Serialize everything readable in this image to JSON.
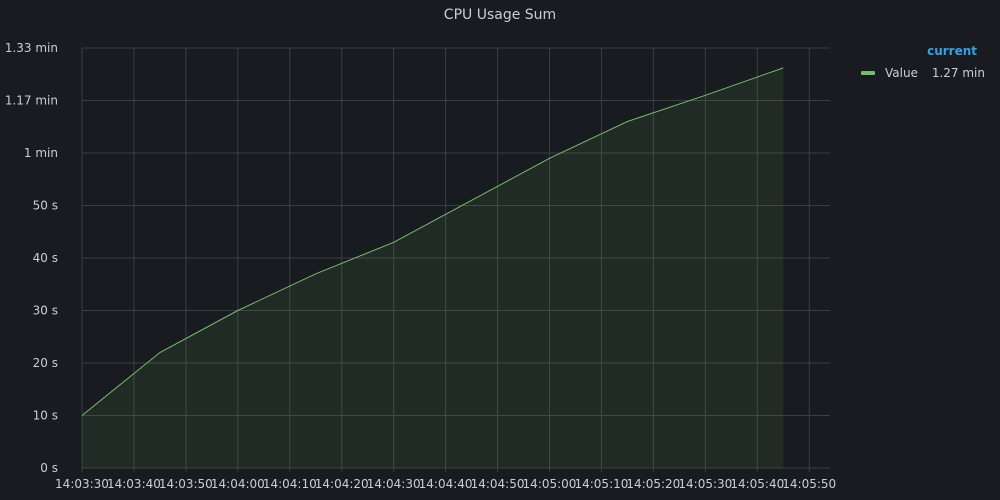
{
  "panel": {
    "title": "CPU Usage Sum"
  },
  "legend": {
    "header": "current",
    "items": [
      {
        "name": "Value",
        "current": "1.27 min",
        "color": "#73bf69"
      }
    ]
  },
  "colors": {
    "background": "#181b1f",
    "grid": "#3a3d42",
    "text": "#ccccdc",
    "series": "#73bf69",
    "legend_header": "#33a2e5"
  },
  "chart_data": {
    "type": "area",
    "title": "CPU Usage Sum",
    "xlabel": "",
    "ylabel": "",
    "grid": true,
    "legend_placement": "right",
    "x_unit": "time",
    "y_unit": "seconds",
    "x_tick_labels": [
      "14:03:30",
      "14:03:40",
      "14:03:50",
      "14:04:00",
      "14:04:10",
      "14:04:20",
      "14:04:30",
      "14:04:40",
      "14:04:50",
      "14:05:00",
      "14:05:10",
      "14:05:20",
      "14:05:30",
      "14:05:40",
      "14:05:50"
    ],
    "y_tick_values": [
      0,
      10,
      20,
      30,
      40,
      50,
      60,
      70,
      80
    ],
    "y_tick_labels": [
      "0 s",
      "10 s",
      "20 s",
      "30 s",
      "40 s",
      "50 s",
      "1 min",
      "1.17 min",
      "1.33 min"
    ],
    "xlim": [
      "14:03:30",
      "14:05:54"
    ],
    "ylim": [
      0,
      80
    ],
    "series": [
      {
        "name": "Value",
        "color": "#73bf69",
        "x": [
          "14:03:30",
          "14:03:45",
          "14:04:00",
          "14:04:15",
          "14:04:30",
          "14:04:45",
          "14:05:00",
          "14:05:15",
          "14:05:30",
          "14:05:45"
        ],
        "y": [
          10,
          22,
          30,
          37,
          43,
          51,
          59,
          66,
          71,
          76.2
        ]
      }
    ]
  }
}
